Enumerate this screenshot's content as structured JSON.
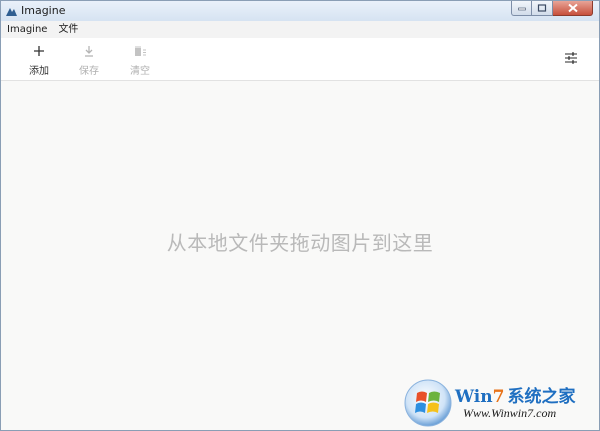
{
  "window": {
    "title": "Imagine"
  },
  "menu": {
    "items": [
      "Imagine",
      "文件"
    ]
  },
  "toolbar": {
    "add_label": "添加",
    "save_label": "保存",
    "clear_label": "清空"
  },
  "main": {
    "drop_hint": "从本地文件夹拖动图片到这里"
  },
  "watermark": {
    "brand_win": "Win",
    "brand_seven": "7",
    "brand_rest": "系统之家",
    "url": "Www.Winwin7.com"
  },
  "colors": {
    "drop_bg": "#f9f9f8",
    "disabled_text": "#b0b0b0",
    "hint_text": "#b9b9b9"
  }
}
